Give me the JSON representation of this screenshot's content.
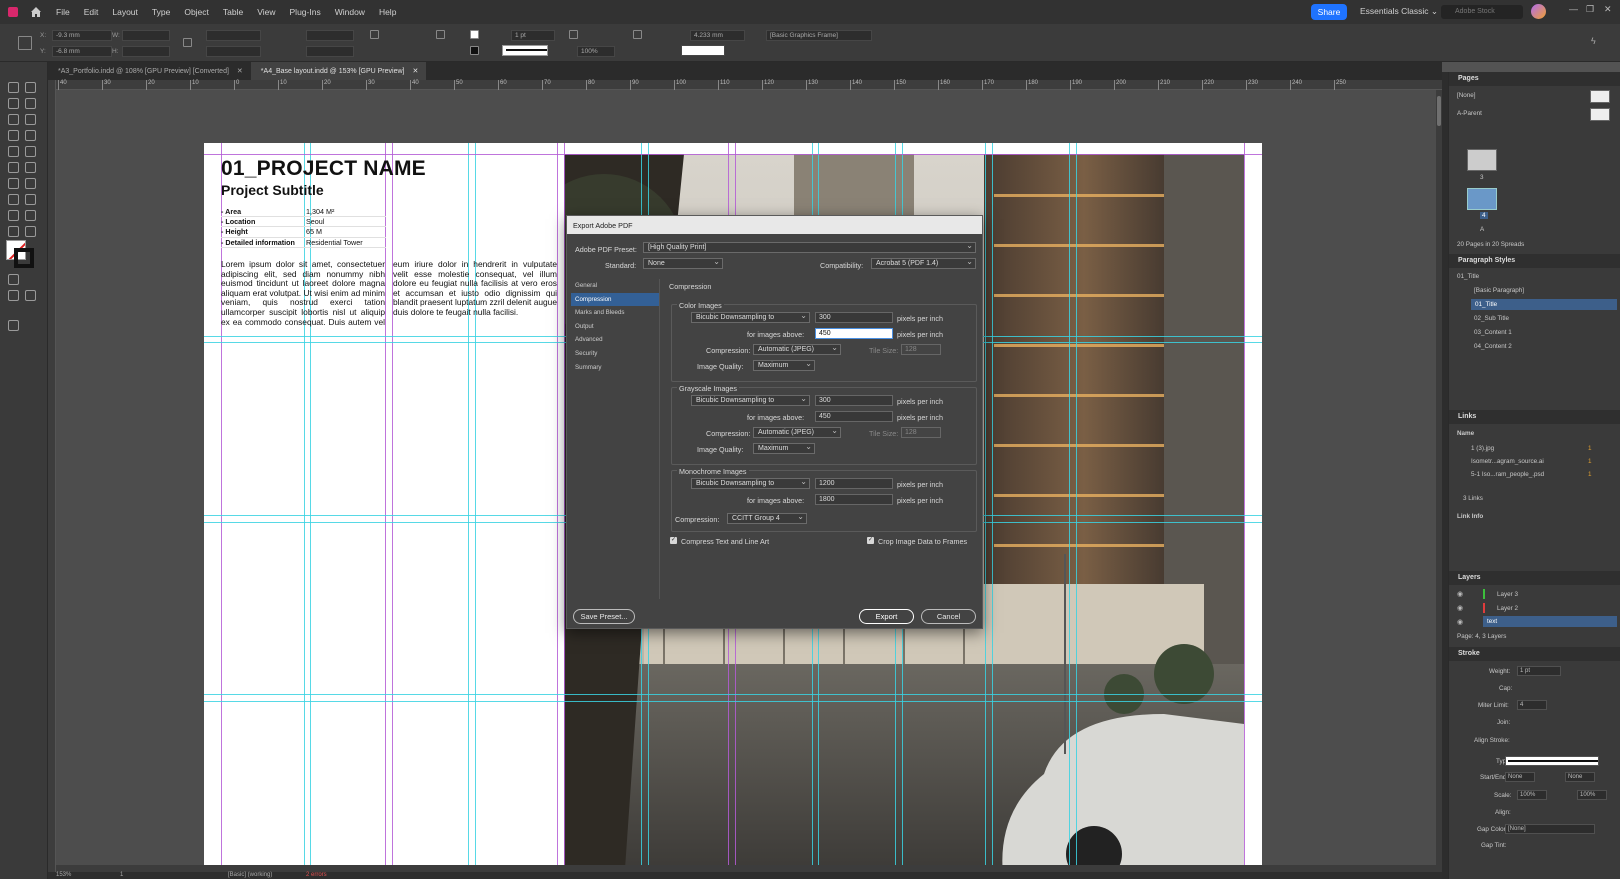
{
  "menu": [
    "File",
    "Edit",
    "Layout",
    "Type",
    "Object",
    "Table",
    "View",
    "Plug-Ins",
    "Window",
    "Help"
  ],
  "share_label": "Share",
  "workspace_label": "Essentials Classic",
  "stock_placeholder": "Adobe Stock",
  "control": {
    "x": "-9.3 mm",
    "y": "-6.8 mm",
    "w_label": "W:",
    "h_label": "H:",
    "stroke_weight": "1 pt",
    "scale": "100%",
    "offset": "4.233 mm",
    "frame_style": "[Basic Graphics Frame]"
  },
  "tabs": [
    {
      "label": "*A3_Portfolio.indd @ 108% [GPU Preview] [Converted]"
    },
    {
      "label": "*A4_Base layout.indd @ 153% [GPU Preview]"
    }
  ],
  "ruler": [
    "40",
    "30",
    "20",
    "10",
    "0",
    "10",
    "20",
    "30",
    "40",
    "50",
    "60",
    "70",
    "80",
    "90",
    "100",
    "110",
    "120",
    "130",
    "140",
    "150",
    "160",
    "170",
    "180",
    "190",
    "200",
    "210",
    "220",
    "230",
    "240",
    "250"
  ],
  "page": {
    "title": "01_PROJECT NAME",
    "subtitle": "Project Subtitle",
    "info": [
      {
        "k": "- Area",
        "v": "1,304 M²"
      },
      {
        "k": "- Location",
        "v": "Seoul"
      },
      {
        "k": "- Height",
        "v": "65 M"
      },
      {
        "k": "- Detailed information",
        "v": "Residential Tower"
      }
    ],
    "body": "Lorem ipsum dolor sit amet, consectetuer adipiscing elit, sed diam nonummy nibh euismod tincidunt ut laoreet dolore magna aliquam erat volutpat. Ut wisi enim ad minim veniam, quis nostrud exerci tation ullamcorper suscipit lobortis nisl ut aliquip ex ea commodo consequat. Duis autem vel eum iriure dolor in hendrerit in vulputate velit esse molestie consequat, vel illum dolore eu feugiat nulla facilisis at vero eros et accumsan et iusto odio dignissim qui blandit praesent luptatum zzril delenit augue duis dolore te feugait nulla facilisi."
  },
  "dialog": {
    "title": "Export Adobe PDF",
    "preset_label": "Adobe PDF Preset:",
    "preset_value": "[High Quality Print]",
    "standard_label": "Standard:",
    "standard_value": "None",
    "compat_label": "Compatibility:",
    "compat_value": "Acrobat 5 (PDF 1.4)",
    "nav": [
      "General",
      "Compression",
      "Marks and Bleeds",
      "Output",
      "Advanced",
      "Security",
      "Summary"
    ],
    "section_title": "Compression",
    "color": {
      "title": "Color Images",
      "method": "Bicubic Downsampling to",
      "ppi": "300",
      "above_label": "for images above:",
      "above": "450",
      "unit": "pixels per inch",
      "comp_label": "Compression:",
      "comp": "Automatic (JPEG)",
      "tile_label": "Tile Size:",
      "tile": "128",
      "quality_label": "Image Quality:",
      "quality": "Maximum"
    },
    "gray": {
      "title": "Grayscale Images",
      "method": "Bicubic Downsampling to",
      "ppi": "300",
      "above_label": "for images above:",
      "above": "450",
      "unit": "pixels per inch",
      "comp_label": "Compression:",
      "comp": "Automatic (JPEG)",
      "tile_label": "Tile Size:",
      "tile": "128",
      "quality_label": "Image Quality:",
      "quality": "Maximum"
    },
    "mono": {
      "title": "Monochrome Images",
      "method": "Bicubic Downsampling to",
      "ppi": "1200",
      "above_label": "for images above:",
      "above": "1800",
      "unit": "pixels per inch",
      "comp_label": "Compression:",
      "comp": "CCITT Group 4"
    },
    "compress_text": "Compress Text and Line Art",
    "crop_image": "Crop Image Data to Frames",
    "save_preset": "Save Preset...",
    "export": "Export",
    "cancel": "Cancel"
  },
  "pages_panel": {
    "title": "Pages",
    "none": "[None]",
    "parent": "A-Parent",
    "p3": "3",
    "p4": "4",
    "p5": "A",
    "footer": "20 Pages in 20 Spreads"
  },
  "para_panel": {
    "title": "Paragraph Styles",
    "current": "01_Title",
    "items": [
      "[Basic Paragraph]",
      "01_Title",
      "02_Sub Title",
      "03_Content 1",
      "04_Content 2"
    ]
  },
  "links_panel": {
    "title": "Links",
    "name_col": "Name",
    "items": [
      {
        "name": "1 (3).jpg",
        "page": "1"
      },
      {
        "name": "Isometr...agram_source.ai",
        "page": "1"
      },
      {
        "name": "5-1 Iso...ram_people_.psd",
        "page": "1"
      }
    ],
    "count": "3 Links",
    "info": "Link Info"
  },
  "layers_panel": {
    "title": "Layers",
    "items": [
      "Layer 3",
      "Layer 2",
      "text"
    ],
    "footer": "Page: 4, 3 Layers"
  },
  "stroke_panel": {
    "title": "Stroke",
    "weight_label": "Weight:",
    "weight": "1 pt",
    "cap_label": "Cap:",
    "miter_label": "Miter Limit:",
    "miter": "4",
    "join_label": "Join:",
    "align_label": "Align Stroke:",
    "type_label": "Type:",
    "start_label": "Start/End:",
    "start": "None",
    "end": "None",
    "scale_label": "Scale:",
    "scale1": "100%",
    "scale2": "100%",
    "align2_label": "Align:",
    "gap_color_label": "Gap Color:",
    "gap_color": "[None]",
    "gap_tint_label": "Gap Tint:"
  },
  "status": {
    "zoom": "153%",
    "page": "1",
    "preflight": "[Basic] (working)",
    "errors": "2 errors"
  }
}
